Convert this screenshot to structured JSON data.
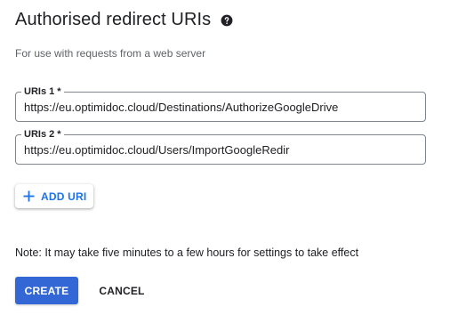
{
  "section": {
    "title": "Authorised redirect URIs",
    "help_icon": "help-circle-icon",
    "subtitle": "For use with requests from a web server"
  },
  "uris": [
    {
      "label": "URIs 1 *",
      "value": "https://eu.optimidoc.cloud/Destinations/AuthorizeGoogleDrive"
    },
    {
      "label": "URIs 2 *",
      "value": "https://eu.optimidoc.cloud/Users/ImportGoogleRedir"
    }
  ],
  "add_uri": {
    "icon": "plus-icon",
    "label": "ADD URI"
  },
  "note": "Note: It may take five minutes to a few hours for settings to take effect",
  "actions": {
    "create_label": "CREATE",
    "cancel_label": "CANCEL"
  },
  "colors": {
    "primary": "#3367d6",
    "link": "#1a73e8",
    "border": "#80868b",
    "text": "#202124",
    "muted": "#5f6368"
  }
}
